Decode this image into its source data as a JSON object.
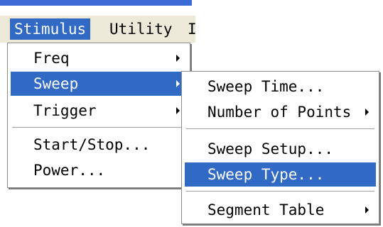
{
  "menubar": {
    "items": [
      {
        "label": "Stimulus"
      },
      {
        "label": "Utility"
      },
      {
        "label": "I"
      }
    ]
  },
  "stimulus_menu": {
    "items": [
      {
        "label": "Freq",
        "submenu": true
      },
      {
        "label": "Sweep",
        "submenu": true,
        "selected": true
      },
      {
        "label": "Trigger",
        "submenu": true
      },
      {
        "label": "Start/Stop..."
      },
      {
        "label": "Power..."
      }
    ]
  },
  "sweep_menu": {
    "items": [
      {
        "label": "Sweep Time..."
      },
      {
        "label": "Number of Points",
        "submenu": true
      },
      {
        "label": "Sweep Setup..."
      },
      {
        "label": "Sweep Type...",
        "selected": true
      },
      {
        "label": "Segment Table",
        "submenu": true
      }
    ]
  },
  "colors": {
    "highlight": "#316ac5",
    "menubar_bg": "#ece9d8",
    "titlebar": "#3c6bd8"
  }
}
